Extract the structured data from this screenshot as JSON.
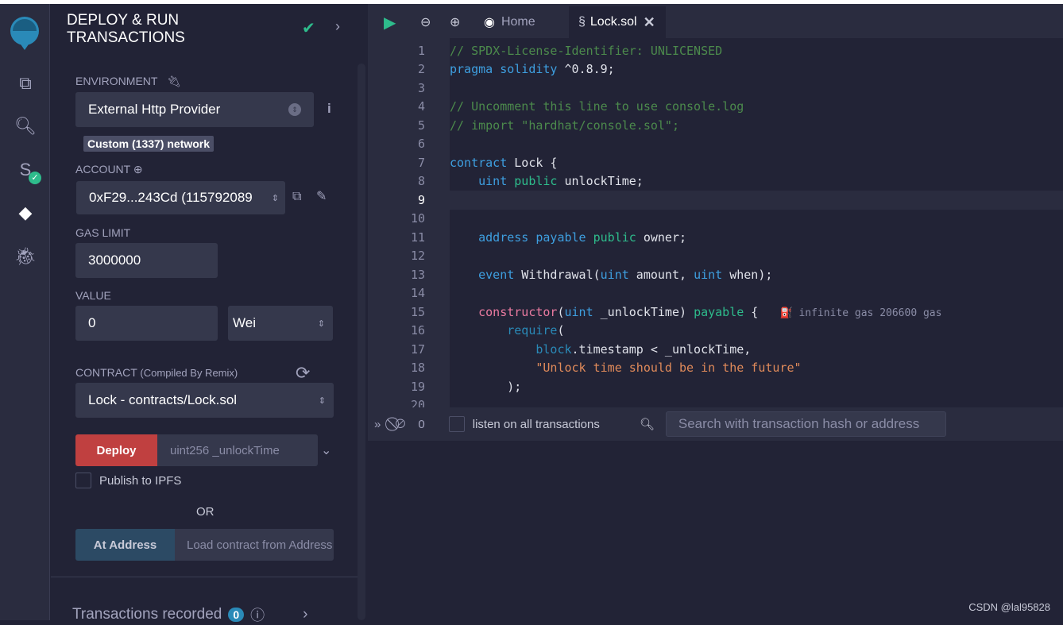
{
  "panel": {
    "title_line1": "DEPLOY & RUN",
    "title_line2": "TRANSACTIONS",
    "environment_label": "ENVIRONMENT",
    "environment_value": "External Http Provider",
    "network_badge": "Custom (1337) network",
    "account_label": "ACCOUNT",
    "account_value": "0xF29...243Cd (115792089",
    "gas_limit_label": "GAS LIMIT",
    "gas_limit_value": "3000000",
    "value_label": "VALUE",
    "value_value": "0",
    "value_unit": "Wei",
    "contract_label": "CONTRACT",
    "contract_sub": "(Compiled By Remix)",
    "contract_value": "Lock - contracts/Lock.sol",
    "deploy_label": "Deploy",
    "deploy_placeholder": "uint256 _unlockTime",
    "publish_label": "Publish to IPFS",
    "or_label": "OR",
    "at_address_label": "At Address",
    "at_address_placeholder": "Load contract from Address",
    "transactions_recorded_label": "Transactions recorded",
    "transactions_count": "0"
  },
  "tabs": {
    "home": "Home",
    "lock": "Lock.sol"
  },
  "code_lines": [
    [
      [
        "// SPDX-License-Identifier: UNLICENSED",
        "com"
      ]
    ],
    [
      [
        "pragma solidity",
        "kw"
      ],
      [
        " ^0.8.9;",
        "pl"
      ]
    ],
    [],
    [
      [
        "// Uncomment this line to use console.log",
        "com"
      ]
    ],
    [
      [
        "// import \"hardhat/console.sol\";",
        "com"
      ]
    ],
    [],
    [
      [
        "contract",
        "kw"
      ],
      [
        " Lock {",
        "pl"
      ]
    ],
    [
      [
        "    uint",
        "kw"
      ],
      [
        " public",
        "pub"
      ],
      [
        " unlockTime;",
        "pl"
      ]
    ],
    [],
    [],
    [
      [
        "    address payable",
        "kw"
      ],
      [
        " public",
        "pub"
      ],
      [
        " owner;",
        "pl"
      ]
    ],
    [],
    [
      [
        "    event",
        "kw"
      ],
      [
        " Withdrawal(",
        "pl"
      ],
      [
        "uint",
        "kw"
      ],
      [
        " amount, ",
        "pl"
      ],
      [
        "uint",
        "kw"
      ],
      [
        " when);",
        "pl"
      ]
    ],
    [],
    [
      [
        "    constructor",
        "ctor"
      ],
      [
        "(",
        "pl"
      ],
      [
        "uint",
        "kw"
      ],
      [
        " _unlockTime) ",
        "pl"
      ],
      [
        "payable",
        "pub"
      ],
      [
        " {   ",
        "pl"
      ],
      [
        "⛽ infinite gas 206600 gas",
        "gas"
      ]
    ],
    [
      [
        "        require",
        "req"
      ],
      [
        "(",
        "pl"
      ]
    ],
    [
      [
        "            block",
        "req"
      ],
      [
        ".timestamp < _unlockTime,",
        "pl"
      ]
    ],
    [
      [
        "            \"Unlock time should be in the future\"",
        "str"
      ]
    ],
    [
      [
        "        );",
        "pl"
      ]
    ],
    []
  ],
  "terminal": {
    "count": "0",
    "listen_label": "listen on all transactions",
    "search_placeholder": "Search with transaction hash or address"
  },
  "watermark": "CSDN @lal95828",
  "colors": {
    "deploy": "#c04040",
    "at_address": "#2c4a64",
    "success": "#2ebc8c"
  }
}
